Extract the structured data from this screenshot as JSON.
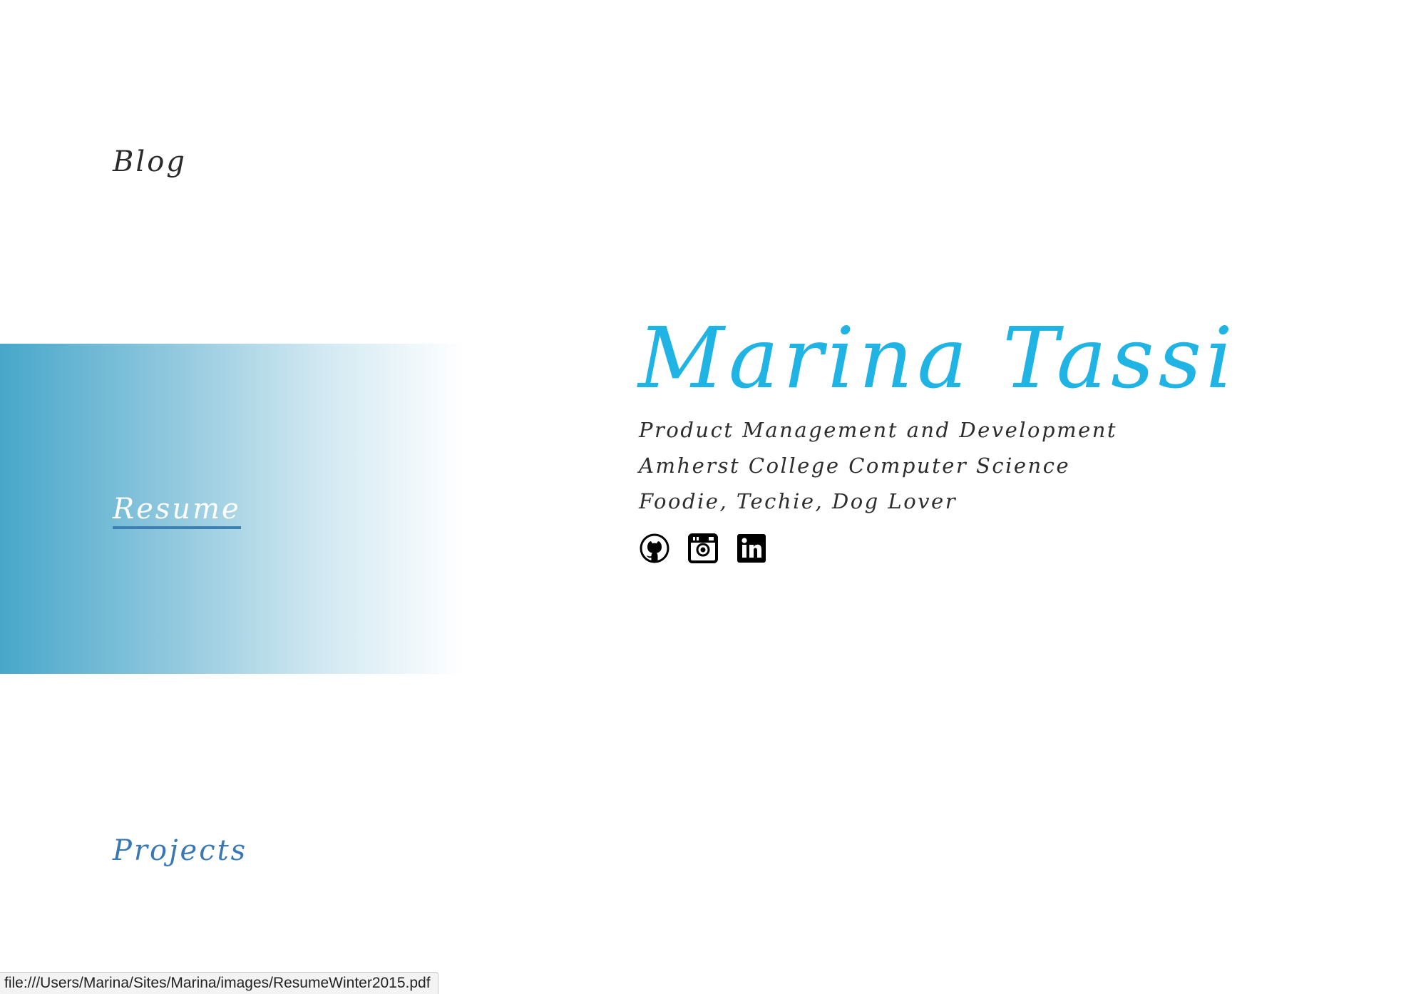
{
  "nav": {
    "blog": "Blog",
    "resume": "Resume",
    "projects": "Projects"
  },
  "hero": {
    "name": "Marina Tassi",
    "taglines": [
      "Product Management and Development",
      "Amherst College Computer Science",
      "Foodie, Techie, Dog Lover"
    ]
  },
  "social": [
    {
      "icon": "github-icon"
    },
    {
      "icon": "instagram-icon"
    },
    {
      "icon": "linkedin-icon"
    }
  ],
  "status_bar": {
    "url": "file:///Users/Marina/Sites/Marina/images/ResumeWinter2015.pdf"
  },
  "colors": {
    "accent": "#1fb4e3",
    "link": "#3a78b5",
    "band_start": "#47a7ca"
  }
}
